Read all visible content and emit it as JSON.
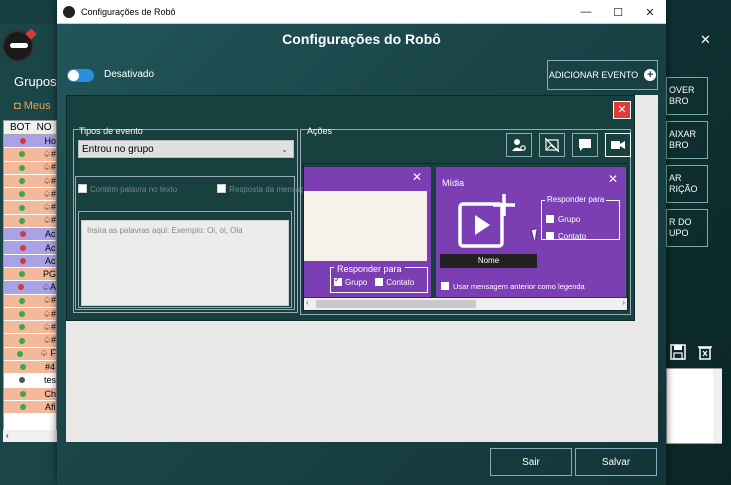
{
  "window": {
    "title": "Configurações de Robô",
    "heading": "Configurações do Robô",
    "controls": {
      "minimize": "—",
      "maximize": "☐",
      "close": "✕"
    }
  },
  "toolbar": {
    "toggle_label": "Desativado",
    "add_event_label": "ADICIONAR EVENTO"
  },
  "event": {
    "close_label": "✕",
    "tipos_label": "Tipos de evento",
    "tipos_value": "Entrou no grupo",
    "words_placeholder": "Insira as palavras aqui: Exemplo: Oi, oi, Ola",
    "acoes_label": "Ações",
    "checkboxes": [
      "Contém palavra no texto",
      "Resposta da mensagem"
    ]
  },
  "cards": {
    "text_card": {
      "close": "✕",
      "respond_title": "Responder para",
      "options": [
        "Grupo",
        "Contato"
      ]
    },
    "media_card": {
      "title": "Mídia",
      "close": "✕",
      "name_label": "Nome",
      "respond_title": "Responder para",
      "options": [
        "Grupo",
        "Contato"
      ],
      "legend_label": "Usar mensagem anterior como legenda"
    }
  },
  "buttons": {
    "exit": "Sair",
    "save": "Salvar"
  },
  "background": {
    "grupos": "Grupos:",
    "meus": "Meus",
    "table_headers": [
      "BOT",
      "NO"
    ],
    "rows": [
      {
        "dot": "#d43a3a",
        "text": "Ho",
        "bg": "#a9a3e6"
      },
      {
        "dot": "#3aa84a",
        "text": "♤#",
        "bg": "#f4b89a"
      },
      {
        "dot": "#3aa84a",
        "text": "♤#",
        "bg": "#f4b89a"
      },
      {
        "dot": "#3aa84a",
        "text": "♤#",
        "bg": "#f4b89a"
      },
      {
        "dot": "#3aa84a",
        "text": "♤#",
        "bg": "#f4b89a"
      },
      {
        "dot": "#3aa84a",
        "text": "♤#",
        "bg": "#f4b89a"
      },
      {
        "dot": "#3aa84a",
        "text": "♤#",
        "bg": "#f4b89a"
      },
      {
        "dot": "#d43a3a",
        "text": "Ac",
        "bg": "#a9a3e6"
      },
      {
        "dot": "#d43a3a",
        "text": "Ac",
        "bg": "#a9a3e6"
      },
      {
        "dot": "#d43a3a",
        "text": "Ac",
        "bg": "#a9a3e6"
      },
      {
        "dot": "#3aa84a",
        "text": "PG",
        "bg": "#f4b89a"
      },
      {
        "dot": "#d43a3a",
        "text": "♤A",
        "bg": "#a9a3e6"
      },
      {
        "dot": "#3aa84a",
        "text": "♤#",
        "bg": "#f4b89a"
      },
      {
        "dot": "#3aa84a",
        "text": "♤#",
        "bg": "#f4b89a"
      },
      {
        "dot": "#3aa84a",
        "text": "♤#",
        "bg": "#f4b89a"
      },
      {
        "dot": "#3aa84a",
        "text": "♤#",
        "bg": "#f4b89a"
      },
      {
        "dot": "#3aa84a",
        "text": "♤ F",
        "bg": "#f4b89a"
      },
      {
        "dot": "#3aa84a",
        "text": "#4",
        "bg": "#f4b89a"
      },
      {
        "dot": "#555555",
        "text": "tes",
        "bg": "#ffffff"
      },
      {
        "dot": "#3aa84a",
        "text": "Ch",
        "bg": "#f4b89a"
      },
      {
        "dot": "#3aa84a",
        "text": "Afi",
        "bg": "#f4b89a"
      }
    ],
    "right_buttons": [
      "OVER\nBRO",
      "AIXAR\nBRO",
      "AR\nRIÇÃO",
      "R DO\nUPO"
    ],
    "right_x": "✕",
    "right_bar": "|"
  },
  "colors": {
    "accent_purple": "#7b3fb3",
    "close_red": "#e53935",
    "toggle_blue": "#2a8fd8"
  }
}
